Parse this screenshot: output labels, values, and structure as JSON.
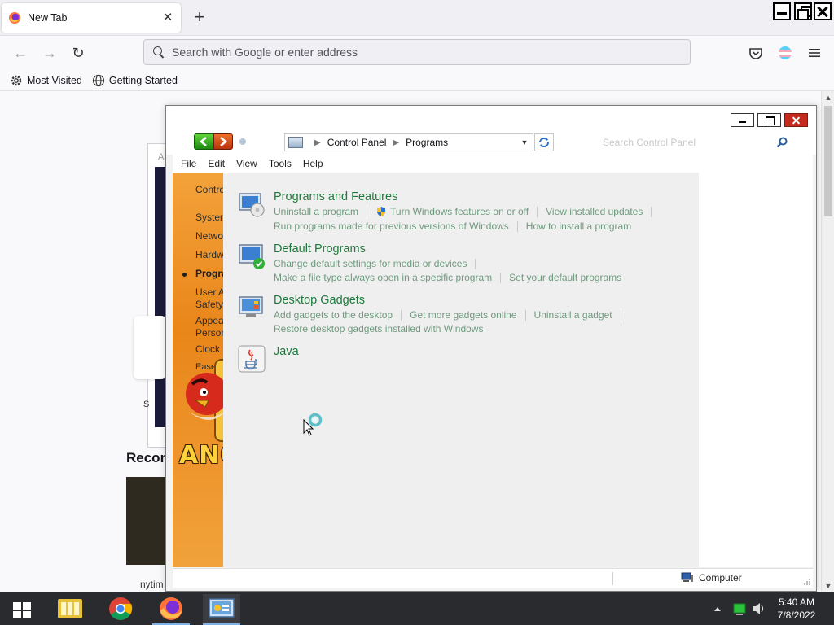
{
  "browser": {
    "tab_title": "New Tab",
    "new_tab_symbol": "+",
    "close_symbol": "✕",
    "url_placeholder": "Search with Google or enter address",
    "bookmarks": [
      {
        "label": "Most Visited",
        "icon": "gear-icon"
      },
      {
        "label": "Getting Started",
        "icon": "globe-icon"
      }
    ],
    "newtab_partial": {
      "recommended": "Recom",
      "source": "nytim",
      "s_char": "S",
      "a_char": "A"
    }
  },
  "control_panel": {
    "breadcrumb": [
      "Control Panel",
      "Programs"
    ],
    "search_placeholder": "Search Control Panel",
    "menu": [
      "File",
      "Edit",
      "View",
      "Tools",
      "Help"
    ],
    "left_links": [
      {
        "label": "Contro",
        "current": false
      },
      {
        "label": "Systen",
        "current": false
      },
      {
        "label": "Netwo",
        "current": false
      },
      {
        "label": "Hardw",
        "current": false
      },
      {
        "label": "Progra",
        "current": true
      },
      {
        "label": "User A",
        "current": false
      },
      {
        "label": "Safety",
        "current": false
      },
      {
        "label": "Appea",
        "current": false
      },
      {
        "label": "Persor",
        "current": false
      },
      {
        "label": "Clock",
        "current": false
      },
      {
        "label": "Ease o",
        "current": false
      }
    ],
    "left_logo_text": "ANG",
    "categories": [
      {
        "title": "Programs and Features",
        "icon": "programs-features-icon",
        "rows": [
          [
            {
              "label": "Uninstall a program"
            },
            {
              "label": "Turn Windows features on or off",
              "shield": true
            },
            {
              "label": "View installed updates"
            }
          ],
          [
            {
              "label": "Run programs made for previous versions of Windows"
            },
            {
              "label": "How to install a program"
            }
          ]
        ]
      },
      {
        "title": "Default Programs",
        "icon": "default-programs-icon",
        "rows": [
          [
            {
              "label": "Change default settings for media or devices"
            }
          ],
          [
            {
              "label": "Make a file type always open in a specific program"
            },
            {
              "label": "Set your default programs"
            }
          ]
        ]
      },
      {
        "title": "Desktop Gadgets",
        "icon": "desktop-gadgets-icon",
        "rows": [
          [
            {
              "label": "Add gadgets to the desktop"
            },
            {
              "label": "Get more gadgets online"
            },
            {
              "label": "Uninstall a gadget"
            }
          ],
          [
            {
              "label": "Restore desktop gadgets installed with Windows"
            }
          ]
        ]
      },
      {
        "title": "Java",
        "icon": "java-icon",
        "rows": []
      }
    ],
    "status_text": "Computer"
  },
  "taskbar": {
    "time": "5:40 AM",
    "date": "7/8/2022",
    "apps": [
      "file-explorer-icon",
      "chrome-icon",
      "firefox-icon",
      "control-panel-icon"
    ]
  },
  "colors": {
    "link_green": "#1e7a3c",
    "sublink_green": "#6f9a7e",
    "close_red": "#c42b1c",
    "taskbar_bg": "#2a2b2e",
    "sidebar_orange": "#e9861a"
  }
}
